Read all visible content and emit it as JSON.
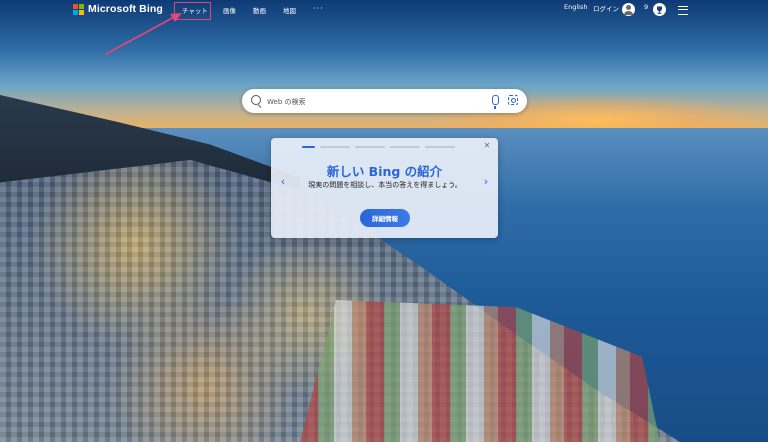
{
  "header": {
    "brand": "Microsoft Bing",
    "nav": {
      "chat": "チャット",
      "images": "画像",
      "videos": "動画",
      "maps": "地図",
      "more": "···"
    },
    "language": "English",
    "login": "ログイン",
    "rewards_points": "9"
  },
  "search": {
    "placeholder": "Web の検索"
  },
  "promo": {
    "title": "新しい Bing の紹介",
    "body": "現実の問題を相談し、本当の答えを得ましょう。",
    "button_label": "詳細情報",
    "close_glyph": "✕",
    "prev_glyph": "‹",
    "next_glyph": "›",
    "active_slide": 1,
    "total_slides": 5
  },
  "icons": {
    "logo": "microsoft-logo-icon",
    "avatar": "user-avatar-icon",
    "rewards": "rewards-icon",
    "menu": "hamburger-menu-icon",
    "search": "search-icon",
    "mic": "microphone-icon",
    "visual_search": "visual-search-icon"
  },
  "colors": {
    "accent": "#2b66d9",
    "annotation": "#e0457b",
    "ms_red": "#f25022",
    "ms_green": "#7fba00",
    "ms_blue": "#00a4ef",
    "ms_yellow": "#ffb900"
  }
}
